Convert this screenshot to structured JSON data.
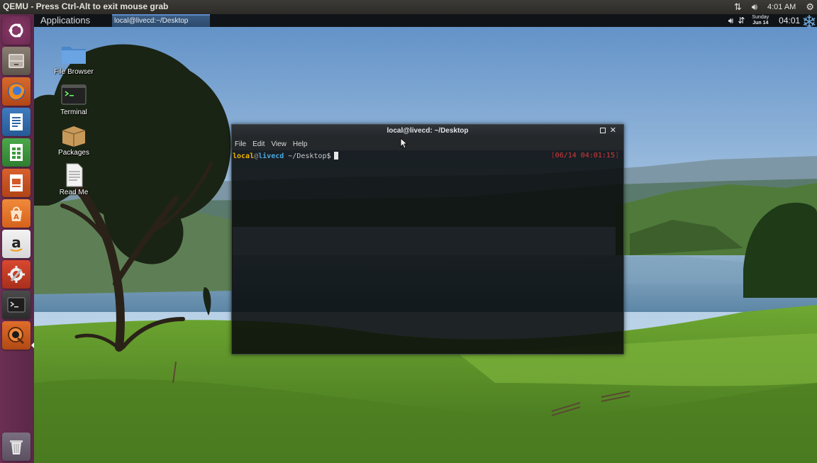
{
  "host": {
    "title": "QEMU - Press Ctrl-Alt to exit mouse grab",
    "time": "4:01 AM",
    "tray_icons": [
      "network-updown-icon",
      "volume-icon",
      "gear-icon"
    ]
  },
  "launcher": {
    "items": [
      {
        "name": "ubuntu-dash",
        "icon": "ubuntu-logo-icon"
      },
      {
        "name": "files",
        "icon": "file-cabinet-icon"
      },
      {
        "name": "firefox",
        "icon": "firefox-icon"
      },
      {
        "name": "libreoffice-writer",
        "icon": "writer-icon"
      },
      {
        "name": "libreoffice-calc",
        "icon": "calc-icon"
      },
      {
        "name": "libreoffice-impress",
        "icon": "impress-icon"
      },
      {
        "name": "ubuntu-software",
        "icon": "software-center-icon"
      },
      {
        "name": "amazon",
        "icon": "amazon-icon"
      },
      {
        "name": "system-settings",
        "icon": "settings-icon"
      },
      {
        "name": "terminal",
        "icon": "terminal-icon"
      },
      {
        "name": "qemu",
        "icon": "qemu-icon"
      },
      {
        "name": "trash",
        "icon": "trash-icon"
      }
    ]
  },
  "guest_panel": {
    "applications_label": "Applications",
    "task_label": "local@livecd:~/Desktop",
    "date_day": "Sunday",
    "date_date": "Jun 14",
    "time": "04:01",
    "logo": "snowflake-icon"
  },
  "desktop": {
    "icons": [
      {
        "label": "File Browser",
        "icon": "folder-icon"
      },
      {
        "label": "Terminal",
        "icon": "terminal-icon"
      },
      {
        "label": "Packages",
        "icon": "package-box-icon"
      },
      {
        "label": "Read Me",
        "icon": "document-icon"
      }
    ]
  },
  "terminal": {
    "title": "local@livecd: ~/Desktop",
    "menu": [
      "File",
      "Edit",
      "View",
      "Help"
    ],
    "prompt_user": "local",
    "prompt_at": "@",
    "prompt_host": "livecd",
    "prompt_path": " ~/Desktop",
    "prompt_symbol": "$",
    "timestamp": "06/14 04:01:15",
    "ts_open": "[",
    "ts_close": "]"
  },
  "colors": {
    "launcher": "#5c2748",
    "prompt_user": "#f0b400",
    "prompt_host": "#4aa8e0",
    "timestamp": "#d43b3b"
  }
}
